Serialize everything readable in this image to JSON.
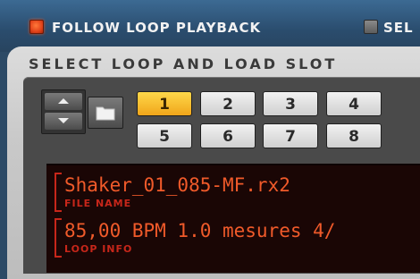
{
  "top": {
    "follow_label": "FOLLOW LOOP PLAYBACK",
    "follow_checked": true,
    "sel_label": "SEL",
    "sel_checked": false
  },
  "panel": {
    "title": "SELECT LOOP AND LOAD SLOT"
  },
  "nav": {
    "up_icon": "arrow-up-icon",
    "down_icon": "arrow-down-icon",
    "folder_icon": "folder-icon"
  },
  "slots": [
    {
      "label": "1",
      "active": true
    },
    {
      "label": "2",
      "active": false
    },
    {
      "label": "3",
      "active": false
    },
    {
      "label": "4",
      "active": false
    },
    {
      "label": "5",
      "active": false
    },
    {
      "label": "6",
      "active": false
    },
    {
      "label": "7",
      "active": false
    },
    {
      "label": "8",
      "active": false
    }
  ],
  "display": {
    "file_name_value": "Shaker_01_085-MF.rx2",
    "file_name_label": "FILE NAME",
    "loop_info_value": "85,00 BPM  1.0 mesures 4/",
    "loop_info_label": "LOOP INFO"
  },
  "colors": {
    "checkbox_on": "#e2431a",
    "slot_active": "#f0a51a",
    "display_text": "#f05a2a",
    "display_bg": "#1a0605"
  }
}
